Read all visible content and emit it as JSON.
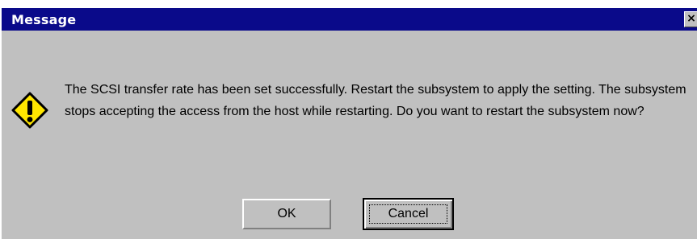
{
  "window": {
    "title": "Message",
    "close_glyph": "×"
  },
  "icon": "warning-icon",
  "message": "The SCSI transfer rate has been set successfully. Restart the subsystem to apply the setting. The subsystem stops accepting the access from the host while restarting. Do you want to restart the subsystem now?",
  "buttons": {
    "ok_label": "OK",
    "cancel_label": "Cancel"
  },
  "colors": {
    "titlebar": "#0a0a8a",
    "face": "#c0c0c0",
    "icon_fill": "#ffe600"
  }
}
